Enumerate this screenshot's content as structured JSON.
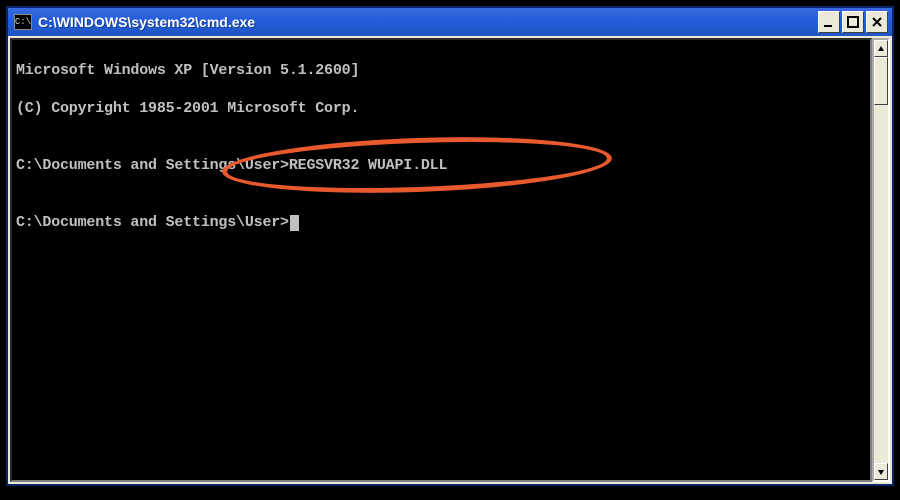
{
  "window": {
    "icon_text": "C:\\",
    "title": "C:\\WINDOWS\\system32\\cmd.exe"
  },
  "terminal": {
    "lines": [
      "Microsoft Windows XP [Version 5.1.2600]",
      "(C) Copyright 1985-2001 Microsoft Corp.",
      "",
      "C:\\Documents and Settings\\User>REGSVR32 WUAPI.DLL",
      "",
      "C:\\Documents and Settings\\User>"
    ]
  },
  "annotation": {
    "kind": "ellipse-highlight",
    "target": "REGSVR32 WUAPI.DLL",
    "color": "#e85a2e"
  }
}
